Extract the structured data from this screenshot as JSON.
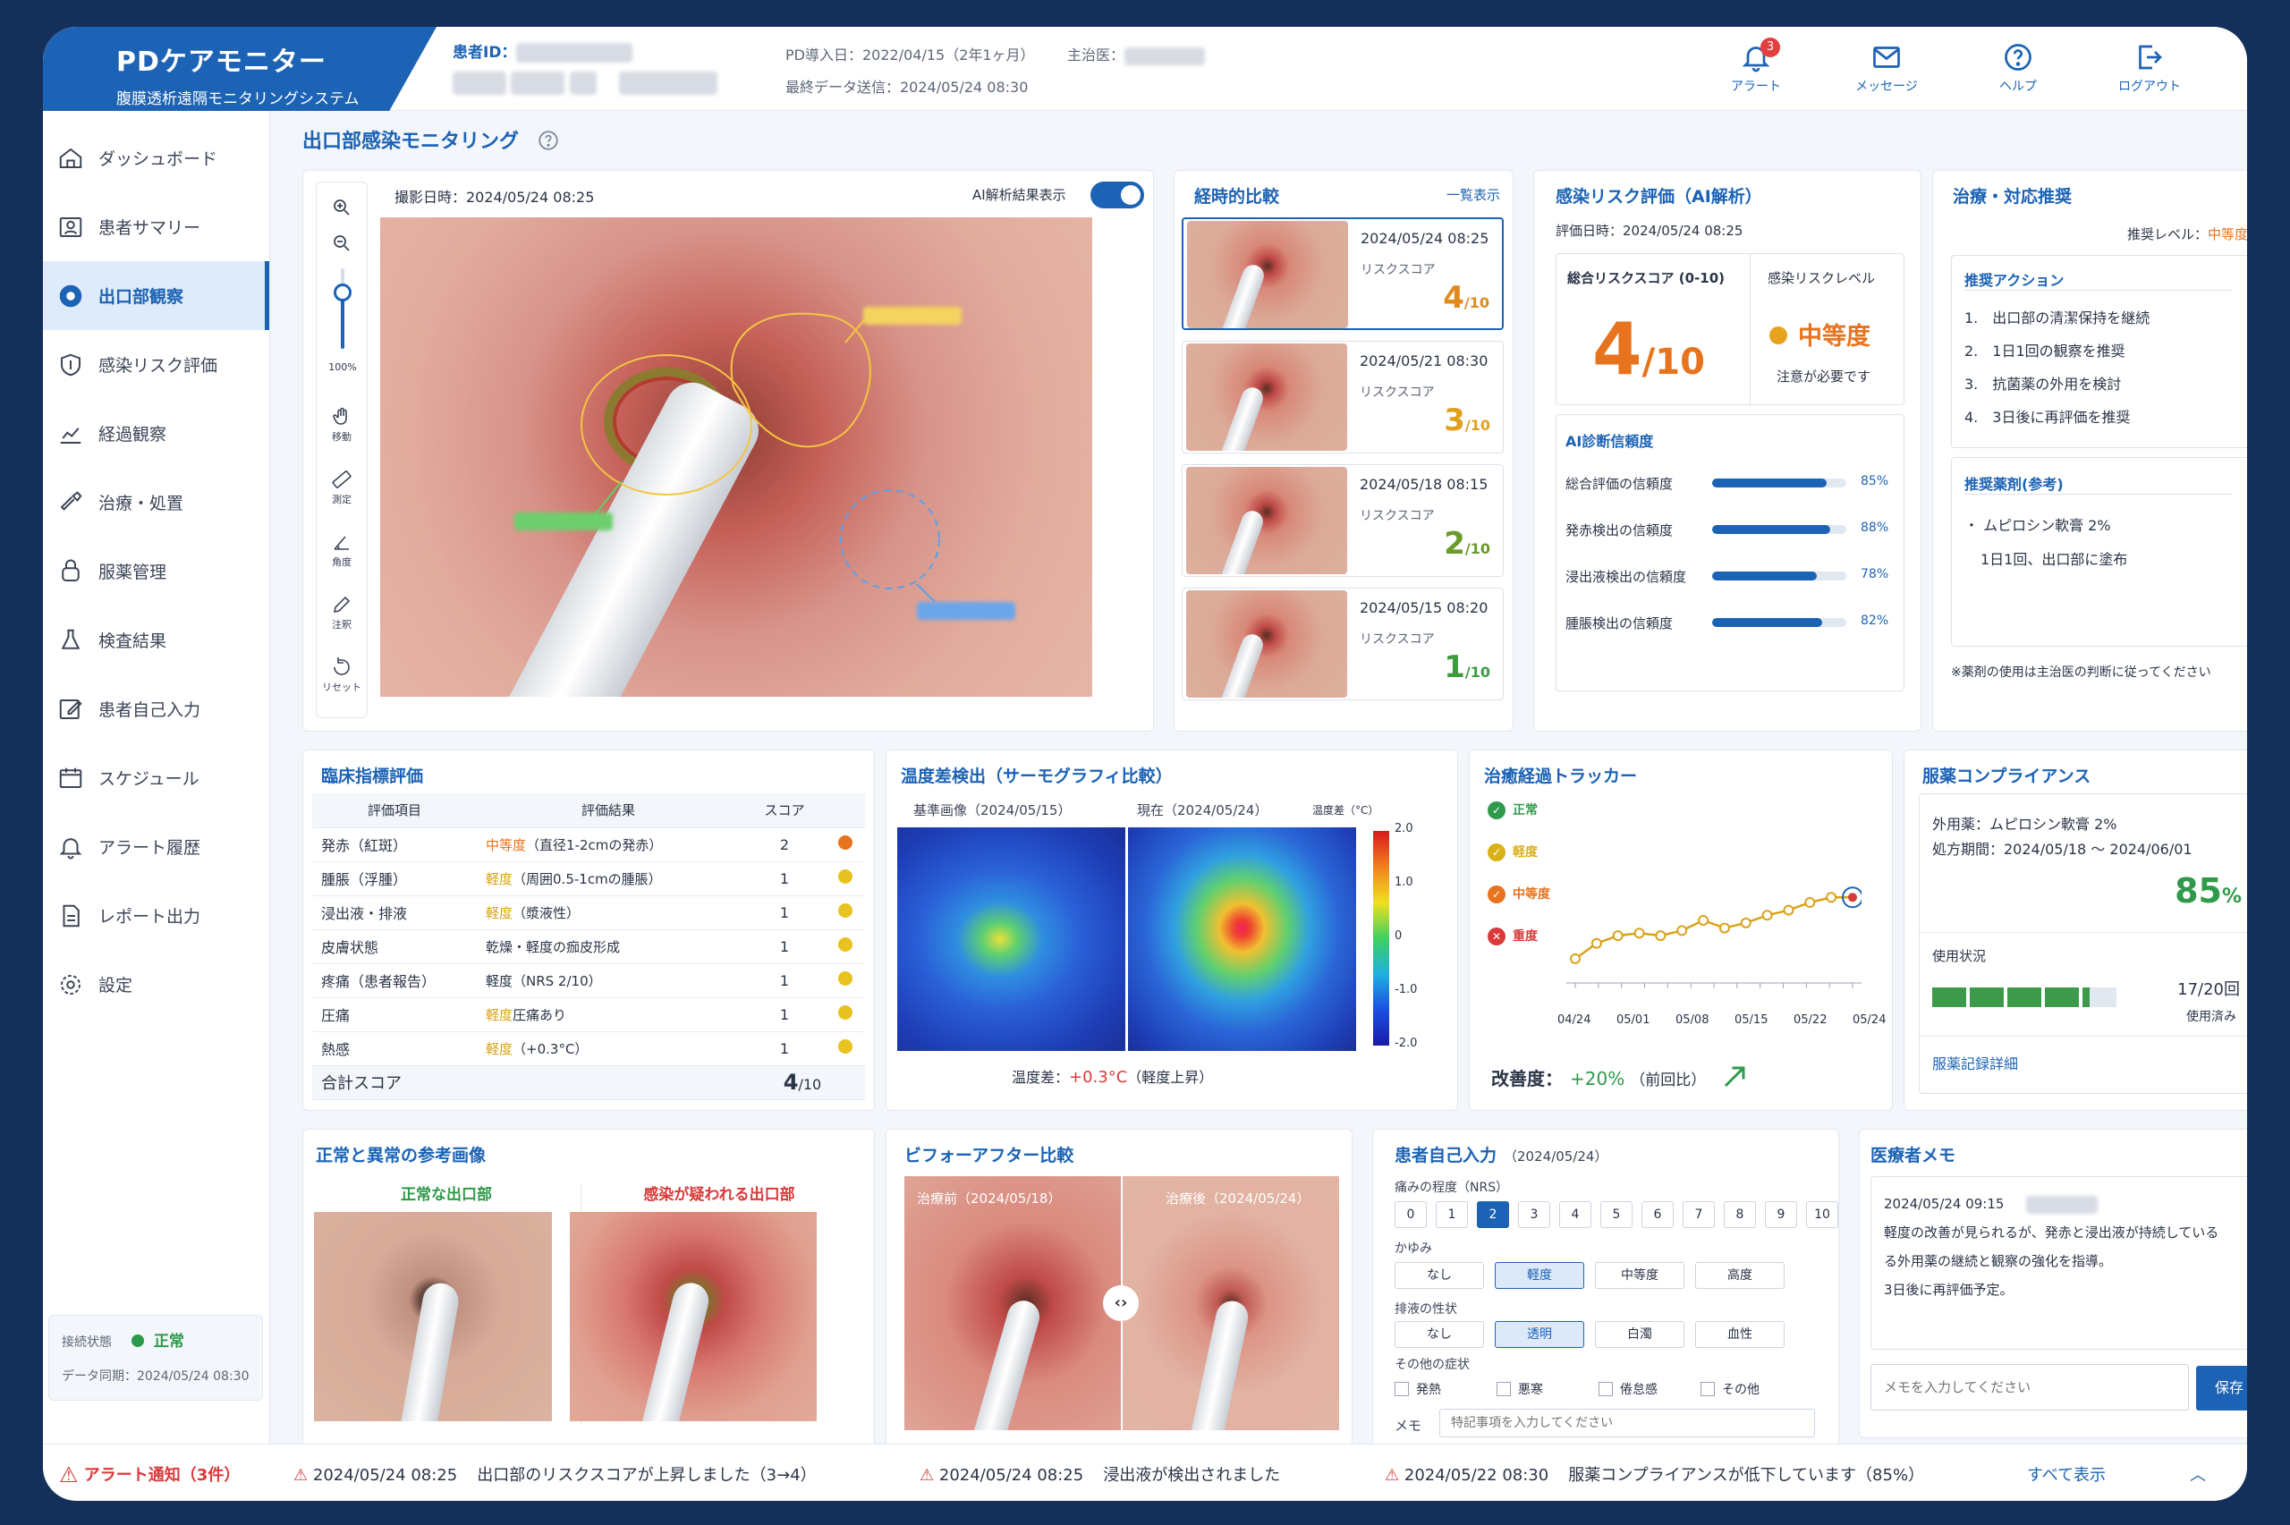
{
  "header": {
    "app_title": "PDケアモニター",
    "app_subtitle": "腹膜透析遠隔モニタリングシステム",
    "patient_id_label": "患者ID：",
    "pd_start": "PD導入日：2022/04/15（2年1ヶ月）",
    "doctor_label": "主治医：",
    "last_sent": "最終データ送信：2024/05/24 08:30",
    "buttons": [
      {
        "label": "アラート",
        "icon": "bell-icon",
        "badge": "3"
      },
      {
        "label": "メッセージ",
        "icon": "mail-icon"
      },
      {
        "label": "ヘルプ",
        "icon": "help-icon"
      },
      {
        "label": "ログアウト",
        "icon": "logout-icon"
      }
    ]
  },
  "sidebar": {
    "items": [
      {
        "label": "ダッシュボード",
        "icon": "home-icon"
      },
      {
        "label": "患者サマリー",
        "icon": "person-card-icon"
      },
      {
        "label": "出口部観察",
        "icon": "exit-site-icon",
        "active": true
      },
      {
        "label": "感染リスク評価",
        "icon": "shield-icon"
      },
      {
        "label": "経過観察",
        "icon": "chart-icon"
      },
      {
        "label": "治療・処置",
        "icon": "tools-icon"
      },
      {
        "label": "服薬管理",
        "icon": "pill-icon"
      },
      {
        "label": "検査結果",
        "icon": "flask-icon"
      },
      {
        "label": "患者自己入力",
        "icon": "edit-icon"
      },
      {
        "label": "スケジュール",
        "icon": "calendar-icon"
      },
      {
        "label": "アラート履歴",
        "icon": "bell-icon"
      },
      {
        "label": "レポート出力",
        "icon": "report-icon"
      },
      {
        "label": "設定",
        "icon": "gear-icon"
      }
    ],
    "connection_label": "接続状態",
    "connection_status": "正常",
    "sync": "データ同期：2024/05/24 08:30"
  },
  "page_title": "出口部感染モニタリング",
  "viewer": {
    "capture": "撮影日時：2024/05/24 08:25",
    "ai_toggle_label": "AI解析結果表示",
    "ai_toggle_on": true,
    "zoom": "100%",
    "zoom_level": 0.7,
    "tools": [
      {
        "label": "移動",
        "icon": "hand-icon"
      },
      {
        "label": "測定",
        "icon": "ruler-icon"
      },
      {
        "label": "角度",
        "icon": "angle-icon"
      },
      {
        "label": "注釈",
        "icon": "pen-icon"
      },
      {
        "label": "リセット",
        "icon": "reset-icon"
      }
    ]
  },
  "timeline": {
    "title": "経時的比較",
    "link": "一覧表示",
    "risk_label": "リスクスコア",
    "unit": "/10",
    "items": [
      {
        "date": "2024/05/24 08:25",
        "score": "4",
        "color": "#e08a1e"
      },
      {
        "date": "2024/05/21 08:30",
        "score": "3",
        "color": "#e0a01e"
      },
      {
        "date": "2024/05/18 08:15",
        "score": "2",
        "color": "#6a9a2a"
      },
      {
        "date": "2024/05/15 08:20",
        "score": "1",
        "color": "#3d9a3d"
      }
    ]
  },
  "risk": {
    "title": "感染リスク評価（AI解析）",
    "date": "評価日時：2024/05/24 08:25",
    "total_label": "総合リスクスコア (0-10)",
    "total": "4",
    "unit": "/10",
    "level_label": "感染リスクレベル",
    "level": "中等度",
    "level_note": "注意が必要です",
    "conf_title": "AI診断信頼度",
    "confidence": [
      {
        "label": "総合評価の信頼度",
        "value": 85,
        "text": "85%"
      },
      {
        "label": "発赤検出の信頼度",
        "value": 88,
        "text": "88%"
      },
      {
        "label": "浸出液検出の信頼度",
        "value": 78,
        "text": "78%"
      },
      {
        "label": "腫脹検出の信頼度",
        "value": 82,
        "text": "82%"
      }
    ]
  },
  "treat": {
    "title": "治療・対応推奨",
    "level_label": "推奨レベル：",
    "level": "中等度",
    "actions_title": "推奨アクション",
    "actions": [
      "1.　出口部の清潔保持を継続",
      "2.　1日1回の観察を推奨",
      "3.　抗菌薬の外用を検討",
      "4.　3日後に再評価を推奨"
    ],
    "drug_title": "推奨薬剤(参考)",
    "drug": "・ ムピロシン軟膏 2%",
    "drug_usage": "1日1回、出口部に塗布",
    "note": "※薬剤の使用は主治医の判断に従ってください"
  },
  "clinical": {
    "title": "臨床指標評価",
    "headers": [
      "評価項目",
      "評価結果",
      "スコア"
    ],
    "rows": [
      {
        "item": "発赤（紅斑）",
        "level": "中等度",
        "detail": "（直径1-2cmの発赤）",
        "score": "2",
        "color": "#e8731e",
        "lc": "#e8731e"
      },
      {
        "item": "腫脹（浮腫）",
        "level": "軽度",
        "detail": "（周囲0.5-1cmの腫脹）",
        "score": "1",
        "color": "#e8c21e",
        "lc": "#d9a31a"
      },
      {
        "item": "浸出液・排液",
        "level": "軽度",
        "detail": "（漿液性）",
        "score": "1",
        "color": "#e8c21e",
        "lc": "#d9a31a"
      },
      {
        "item": "皮膚状態",
        "level": "",
        "detail": "乾燥・軽度の痂皮形成",
        "score": "1",
        "color": "#e8c21e",
        "lc": "#d9a31a"
      },
      {
        "item": "疼痛（患者報告）",
        "level": "",
        "detail": "軽度（NRS 2/10）",
        "score": "1",
        "color": "#e8c21e",
        "lc": "#d9a31a"
      },
      {
        "item": "圧痛",
        "level": "軽度",
        "detail": "圧痛あり",
        "score": "1",
        "color": "#e8c21e",
        "lc": "#d9a31a"
      },
      {
        "item": "熱感",
        "level": "軽度",
        "detail": "（+0.3°C）",
        "score": "1",
        "color": "#e8c21e",
        "lc": "#d9a31a"
      }
    ],
    "total_label": "合計スコア",
    "total": "4",
    "unit": "/10"
  },
  "thermo": {
    "title": "温度差検出（サーモグラフィ比較）",
    "base": "基準画像（2024/05/15）",
    "now": "現在（2024/05/24）",
    "scale_label": "温度差（°C）",
    "ticks": [
      "2.0",
      "1.0",
      "0",
      "-1.0",
      "-2.0"
    ],
    "diff_label": "温度差：",
    "diff": "+0.3°C",
    "diff_note": "（軽度上昇）"
  },
  "tracker": {
    "title": "治癒経過トラッカー",
    "legend": [
      {
        "label": "正常",
        "color": "#2f9a4a",
        "sym": "✓"
      },
      {
        "label": "軽度",
        "color": "#d9b21a",
        "sym": "✓"
      },
      {
        "label": "中等度",
        "color": "#e8731e",
        "sym": "✓"
      },
      {
        "label": "重度",
        "color": "#d93a3a",
        "sym": "✕"
      }
    ],
    "x_labels": [
      "04/24",
      "05/01",
      "05/08",
      "05/15",
      "05/22",
      "05/24"
    ],
    "improve_label": "改善度：",
    "improve": "+20%",
    "improve_note": "（前回比）",
    "chart_data": {
      "type": "line",
      "values": [
        0.6,
        1.2,
        1.5,
        1.6,
        1.5,
        1.7,
        2.1,
        1.8,
        2.0,
        2.3,
        2.5,
        2.8,
        3.0,
        3.0
      ]
    }
  },
  "compliance": {
    "title": "服薬コンプライアンス",
    "drug": "外用薬：ムピロシン軟膏 2%",
    "period": "処方期間：2024/05/18 ～ 2024/06/01",
    "rate": "85",
    "rate_unit": "%",
    "usage_label": "使用状況",
    "used": "17/20回",
    "used_note": "使用済み",
    "segments": [
      1,
      1,
      1,
      1,
      0.2
    ],
    "link": "服薬記録詳細"
  },
  "reference": {
    "title": "正常と異常の参考画像",
    "normal": "正常な出口部",
    "abnormal": "感染が疑われる出口部"
  },
  "beforeafter": {
    "title": "ビフォーアフター比較",
    "before": "治療前（2024/05/18）",
    "after": "治療後（2024/05/24）"
  },
  "selfinput": {
    "title": "患者自己入力",
    "date": "（2024/05/24）",
    "pain_label": "痛みの程度（NRS）",
    "pain": [
      "0",
      "1",
      "2",
      "3",
      "4",
      "5",
      "6",
      "7",
      "8",
      "9",
      "10"
    ],
    "pain_selected": 2,
    "itch_label": "かゆみ",
    "itch": [
      "なし",
      "軽度",
      "中等度",
      "高度"
    ],
    "itch_selected": 1,
    "discharge_label": "排液の性状",
    "discharge": [
      "なし",
      "透明",
      "白濁",
      "血性"
    ],
    "discharge_selected": 1,
    "other_label": "その他の症状",
    "other": [
      "発熱",
      "悪寒",
      "倦怠感",
      "その他"
    ],
    "memo_label": "メモ",
    "memo_placeholder": "特記事項を入力してください"
  },
  "memo": {
    "title": "医療者メモ",
    "date": "2024/05/24 09:15",
    "text1": "軽度の改善が見られるが、発赤と浸出液が持続している",
    "text2": "る外用薬の継続と観察の強化を指導。",
    "text3": "3日後に再評価予定。",
    "placeholder": "メモを入力してください",
    "save": "保存"
  },
  "alerts": {
    "title": "アラート通知（3件）",
    "items": [
      {
        "time": "2024/05/24 08:25",
        "text": "出口部のリスクスコアが上昇しました（3→4）"
      },
      {
        "time": "2024/05/24 08:25",
        "text": "浸出液が検出されました"
      },
      {
        "time": "2024/05/22 08:30",
        "text": "服薬コンプライアンスが低下しています（85%）"
      }
    ],
    "show_all": "すべて表示"
  }
}
